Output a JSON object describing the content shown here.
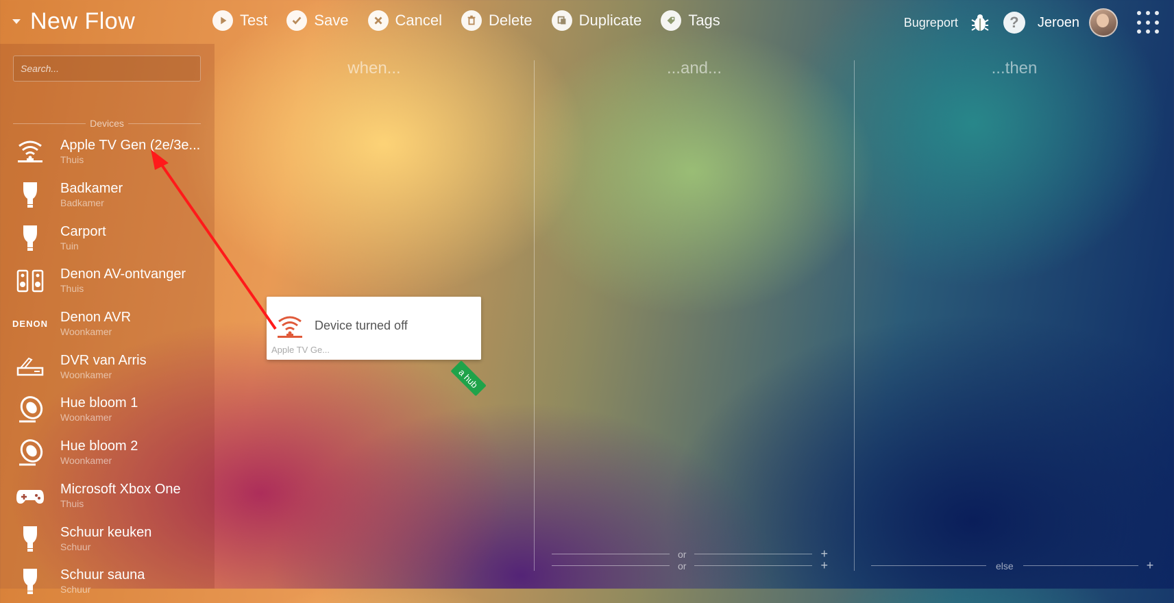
{
  "header": {
    "title": "New Flow",
    "toolbar": [
      {
        "label": "Test",
        "icon": "play-icon"
      },
      {
        "label": "Save",
        "icon": "check-icon"
      },
      {
        "label": "Cancel",
        "icon": "x-icon"
      },
      {
        "label": "Delete",
        "icon": "trash-icon"
      },
      {
        "label": "Duplicate",
        "icon": "copy-icon"
      },
      {
        "label": "Tags",
        "icon": "tag-icon"
      }
    ],
    "bugreport_label": "Bugreport",
    "help_label": "?",
    "user_name": "Jeroen"
  },
  "sidebar": {
    "search_placeholder": "Search...",
    "section_label": "Devices",
    "devices": [
      {
        "name": "Apple TV Gen (2e/3e...",
        "zone": "Thuis",
        "icon": "wifi-remote-icon"
      },
      {
        "name": "Badkamer",
        "zone": "Badkamer",
        "icon": "bulb-icon"
      },
      {
        "name": "Carport",
        "zone": "Tuin",
        "icon": "bulb-icon"
      },
      {
        "name": "Denon AV-ontvanger",
        "zone": "Thuis",
        "icon": "speakers-icon"
      },
      {
        "name": "Denon AVR",
        "zone": "Woonkamer",
        "icon": "denon-logo-icon",
        "logo_text": "DENON"
      },
      {
        "name": "DVR van Arris",
        "zone": "Woonkamer",
        "icon": "settop-box-icon"
      },
      {
        "name": "Hue bloom 1",
        "zone": "Woonkamer",
        "icon": "bloom-lamp-icon"
      },
      {
        "name": "Hue bloom 2",
        "zone": "Woonkamer",
        "icon": "bloom-lamp-icon"
      },
      {
        "name": "Microsoft Xbox One",
        "zone": "Thuis",
        "icon": "gamepad-icon"
      },
      {
        "name": "Schuur keuken",
        "zone": "Schuur",
        "icon": "bulb-icon"
      },
      {
        "name": "Schuur sauna",
        "zone": "Schuur",
        "icon": "bulb-icon"
      }
    ]
  },
  "flow": {
    "columns": [
      "when...",
      "...and...",
      "...then"
    ],
    "card": {
      "title": "Device turned off",
      "subtitle": "Apple TV Ge...",
      "tag": "a hub"
    },
    "and_bottom": [
      "or",
      "or"
    ],
    "then_bottom": "else",
    "plus": "+"
  },
  "colors": {
    "card_icon": "#e05a3a",
    "hub_tag": "#1fa34a",
    "annotation_arrow": "#ff1a1a"
  }
}
